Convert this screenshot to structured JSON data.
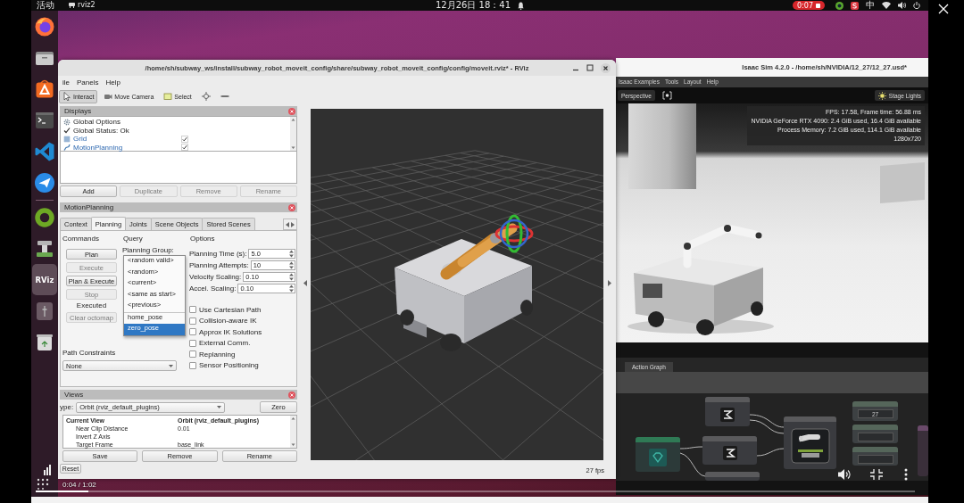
{
  "top_bar": {
    "activities": "活动",
    "app_name": "rviz2",
    "clock": "12月26日 18：41",
    "recording_time": "0:07",
    "input_method": "中"
  },
  "dock": {
    "pinned": [
      {
        "kind": "firefox",
        "selected": false
      },
      {
        "kind": "files",
        "selected": false
      },
      {
        "kind": "app-center",
        "selected": false
      },
      {
        "kind": "terminal",
        "selected": false
      },
      {
        "kind": "vscode",
        "selected": false
      },
      {
        "kind": "messenger",
        "selected": false
      }
    ],
    "others": [
      {
        "kind": "ring",
        "selected": false
      },
      {
        "kind": "isaac",
        "selected": false
      },
      {
        "kind": "rviz",
        "label": "RViz",
        "selected": true
      },
      {
        "kind": "generic",
        "selected": false
      },
      {
        "kind": "trash",
        "selected": false
      }
    ]
  },
  "rviz": {
    "title": "/home/sh/subway_ws/install/subway_robot_moveit_config/share/subway_robot_moveit_config/config/moveit.rviz* - RViz",
    "menu": [
      "ile",
      "Panels",
      "Help"
    ],
    "tools": [
      {
        "kind": "interact",
        "label": "Interact",
        "selected": true
      },
      {
        "kind": "move-camera",
        "label": "Move Camera",
        "selected": false
      },
      {
        "kind": "select",
        "label": "Select",
        "selected": false
      },
      {
        "kind": "focus",
        "selected": false
      },
      {
        "kind": "measure",
        "selected": false
      }
    ],
    "displays": {
      "title": "Displays",
      "items": [
        {
          "kind": "options",
          "label": "Global Options"
        },
        {
          "kind": "status",
          "label": "Global Status: Ok"
        },
        {
          "kind": "grid",
          "label": "Grid",
          "checked": true
        },
        {
          "kind": "planning",
          "label": "MotionPlanning",
          "checked": true
        }
      ],
      "buttons": [
        {
          "label": "Add",
          "disabled": false
        },
        {
          "label": "Duplicate",
          "disabled": true
        },
        {
          "label": "Remove",
          "disabled": true
        },
        {
          "label": "Rename",
          "disabled": true
        }
      ]
    },
    "motion_planning": {
      "title": "MotionPlanning",
      "tabs": [
        {
          "label": "Context",
          "selected": false
        },
        {
          "label": "Planning",
          "selected": true
        },
        {
          "label": "Joints",
          "selected": false
        },
        {
          "label": "Scene Objects",
          "selected": false
        },
        {
          "label": "Stored Scenes",
          "selected": false
        }
      ],
      "columns": [
        "Commands",
        "Query",
        "Options"
      ],
      "commands": [
        {
          "kind": "button",
          "label": "Plan",
          "disabled": false
        },
        {
          "kind": "button",
          "label": "Execute",
          "disabled": true
        },
        {
          "kind": "button",
          "label": "Plan & Execute",
          "disabled": false
        },
        {
          "kind": "button",
          "label": "Stop",
          "disabled": true
        },
        {
          "kind": "status",
          "label": "Executed"
        },
        {
          "kind": "button",
          "label": "Clear octomap",
          "disabled": true
        }
      ],
      "planning_group_label": "Planning Group:",
      "goal_menu": {
        "builtin": [
          {
            "label": "<random valid>",
            "selected": false
          },
          {
            "label": "<random>",
            "selected": false
          },
          {
            "label": "<current>",
            "selected": false
          },
          {
            "label": "<same as start>",
            "selected": false
          },
          {
            "label": "<previous>",
            "selected": false
          }
        ],
        "stored": [
          {
            "label": "home_pose",
            "selected": false
          },
          {
            "label": "zero_pose",
            "selected": true
          }
        ]
      },
      "options": [
        {
          "kind": "spin",
          "label": "Planning Time (s):",
          "value": "5.0"
        },
        {
          "kind": "spin",
          "label": "Planning Attempts:",
          "value": "10"
        },
        {
          "kind": "spin",
          "label": "Velocity Scaling:",
          "value": "0.10"
        },
        {
          "kind": "spin",
          "label": "Accel. Scaling:",
          "value": "0.10"
        },
        {
          "kind": "check",
          "label": "Use Cartesian Path",
          "checked": false
        },
        {
          "kind": "check",
          "label": "Collision-aware IK",
          "checked": false
        },
        {
          "kind": "check",
          "label": "Approx IK Solutions",
          "checked": false
        },
        {
          "kind": "check",
          "label": "External Comm.",
          "checked": false
        },
        {
          "kind": "check",
          "label": "Replanning",
          "checked": false
        },
        {
          "kind": "check",
          "label": "Sensor Positioning",
          "checked": false
        }
      ],
      "path_constraints": {
        "label": "Path Constraints",
        "value": "None"
      }
    },
    "views": {
      "title": "Views",
      "type_label": "ype:",
      "type_value": "Orbit (rviz_default_plugins)",
      "zero_button": "Zero",
      "properties": [
        {
          "kind": "header",
          "name": "Current View",
          "value": "Orbit (rviz_default_plugins)"
        },
        {
          "kind": "field",
          "name": "Near Clip Distance",
          "value": "0.01"
        },
        {
          "kind": "field",
          "name": "Invert Z Axis"
        },
        {
          "kind": "field",
          "name": "Target Frame",
          "value": "base_link"
        }
      ],
      "buttons": [
        "Save",
        "Remove",
        "Rename"
      ]
    },
    "status_bar": {
      "reset_button": "Reset",
      "fps": "27 fps"
    }
  },
  "isaac": {
    "title": "Isaac Sim 4.2.0 - /home/sh/NVIDIA/12_27/12_27.usd*",
    "menu": [
      "Isaac Examples",
      "Tools",
      "Layout",
      "Help"
    ],
    "camera_button": "Perspective",
    "lights_button": "Stage Lights",
    "stats": [
      "FPS: 17.58, Frame time: 56.88 ms",
      "NVIDIA GeForce RTX 4090: 2.4 GiB used, 16.4 GiB available",
      "Process Memory: 7.2 GiB used, 114.1 GiB available",
      "1280x720"
    ],
    "graph_tab": "Action Graph",
    "graph_nodes": [
      {
        "kind": "ros"
      },
      {
        "kind": "function"
      },
      {
        "kind": "function"
      },
      {
        "kind": "articulation"
      },
      {
        "kind": "constant",
        "value": "27"
      },
      {
        "kind": "constant"
      },
      {
        "kind": "constant"
      },
      {
        "kind": "partial"
      },
      {
        "kind": "function"
      }
    ]
  },
  "player": {
    "time": "0:04 / 1:02",
    "level": 0.06
  }
}
